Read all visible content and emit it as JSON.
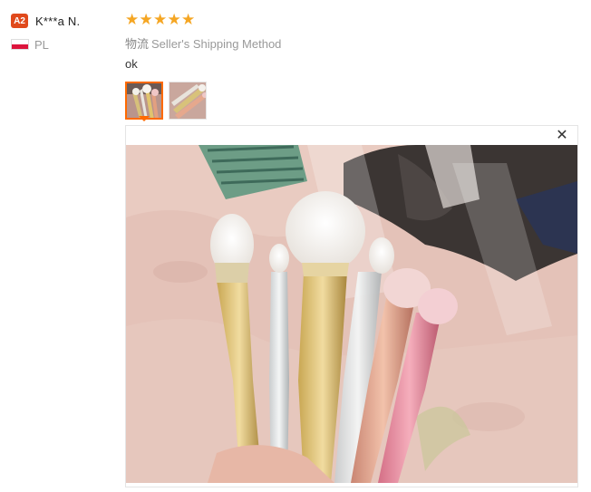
{
  "user": {
    "level_badge": "A2",
    "name": "K***a N.",
    "country": "PL",
    "flag_colors": [
      "#ffffff",
      "#dc143c"
    ]
  },
  "review": {
    "rating": 5,
    "stars": [
      "★",
      "★",
      "★",
      "★",
      "★"
    ],
    "shipping_cn": "物流",
    "shipping_method": "Seller's Shipping Method",
    "comment": "ok",
    "thumbnails": [
      {
        "name": "photo 1",
        "selected": true
      },
      {
        "name": "photo 2",
        "selected": false
      }
    ]
  },
  "viewer": {
    "close_glyph": "✕"
  },
  "colors": {
    "accent": "#ff6a00",
    "star": "#f5a623",
    "badge": "#e0491b"
  }
}
